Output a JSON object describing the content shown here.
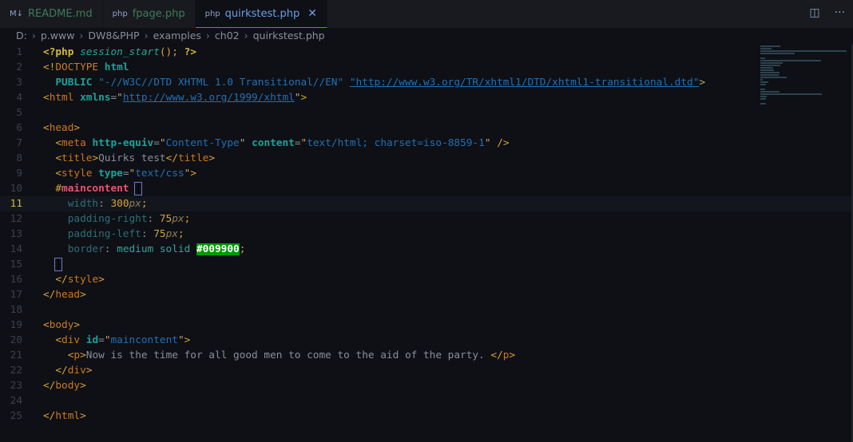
{
  "tabs": [
    {
      "label": "README.md",
      "icon": "markdown-icon",
      "glyph": "M↓",
      "color": "#3f7a5a"
    },
    {
      "label": "fpage.php",
      "icon": "php-icon",
      "glyph": "php",
      "color": "#3f7a5a"
    },
    {
      "label": "quirkstest.php",
      "icon": "php-icon",
      "glyph": "php",
      "active": true
    }
  ],
  "close_glyph": "✕",
  "actions": {
    "split": "◫",
    "more": "···"
  },
  "breadcrumb": [
    "D:",
    "p.www",
    "DW8&PHP",
    "examples",
    "ch02",
    "quirkstest.php"
  ],
  "current_line": 11,
  "lines": [
    [
      [
        "k",
        "<?php"
      ],
      [
        "x",
        " "
      ],
      [
        "f",
        "session_start"
      ],
      [
        "p",
        "();"
      ],
      [
        "x",
        " "
      ],
      [
        "k",
        "?>"
      ]
    ],
    [
      [
        "p",
        "<!"
      ],
      [
        "pl",
        "DOCTYPE"
      ],
      [
        "x",
        " "
      ],
      [
        "a",
        "html"
      ]
    ],
    [
      [
        "x",
        "  "
      ],
      [
        "a",
        "PUBLIC"
      ],
      [
        "x",
        " "
      ],
      [
        "s",
        "\"-//W3C//DTD XHTML 1.0 Transitional//EN\""
      ],
      [
        "x",
        " "
      ],
      [
        "u",
        "\"http://www.w3.org/TR/xhtml1/DTD/xhtml1-transitional.dtd\""
      ],
      [
        "p",
        ">"
      ]
    ],
    [
      [
        "p",
        "<"
      ],
      [
        "t",
        "html"
      ],
      [
        "x",
        " "
      ],
      [
        "a",
        "xmlns"
      ],
      [
        "x",
        "="
      ],
      [
        "q",
        "\""
      ],
      [
        "u",
        "http://www.w3.org/1999/xhtml"
      ],
      [
        "q",
        "\""
      ],
      [
        "p",
        ">"
      ]
    ],
    [],
    [
      [
        "p",
        "<"
      ],
      [
        "t",
        "head"
      ],
      [
        "p",
        ">"
      ]
    ],
    [
      [
        "x",
        "  "
      ],
      [
        "p",
        "<"
      ],
      [
        "t",
        "meta"
      ],
      [
        "x",
        " "
      ],
      [
        "a",
        "http-equiv"
      ],
      [
        "x",
        "="
      ],
      [
        "q",
        "\""
      ],
      [
        "s",
        "Content-Type"
      ],
      [
        "q",
        "\""
      ],
      [
        "x",
        " "
      ],
      [
        "a",
        "content"
      ],
      [
        "x",
        "="
      ],
      [
        "q",
        "\""
      ],
      [
        "s",
        "text/html; charset=iso-8859-1"
      ],
      [
        "q",
        "\""
      ],
      [
        "x",
        " "
      ],
      [
        "p",
        "/>"
      ]
    ],
    [
      [
        "x",
        "  "
      ],
      [
        "p",
        "<"
      ],
      [
        "t",
        "title"
      ],
      [
        "p",
        ">"
      ],
      [
        "x",
        "Quirks test"
      ],
      [
        "p",
        "</"
      ],
      [
        "t",
        "title"
      ],
      [
        "p",
        ">"
      ]
    ],
    [
      [
        "x",
        "  "
      ],
      [
        "p",
        "<"
      ],
      [
        "t",
        "style"
      ],
      [
        "x",
        " "
      ],
      [
        "a",
        "type"
      ],
      [
        "x",
        "="
      ],
      [
        "q",
        "\""
      ],
      [
        "s",
        "text/css"
      ],
      [
        "q",
        "\""
      ],
      [
        "p",
        ">"
      ]
    ],
    [
      [
        "x",
        "  "
      ],
      [
        "p",
        "#"
      ],
      [
        "sel",
        "maincontent"
      ],
      [
        "x",
        " "
      ],
      [
        "br",
        "{"
      ]
    ],
    [
      [
        "x",
        "    "
      ],
      [
        "cp",
        "width"
      ],
      [
        "x",
        ": "
      ],
      [
        "n",
        "300"
      ],
      [
        "un",
        "px"
      ],
      [
        "p",
        ";"
      ]
    ],
    [
      [
        "x",
        "    "
      ],
      [
        "cp",
        "padding-right"
      ],
      [
        "x",
        ": "
      ],
      [
        "n",
        "75"
      ],
      [
        "un",
        "px"
      ],
      [
        "p",
        ";"
      ]
    ],
    [
      [
        "x",
        "    "
      ],
      [
        "cp",
        "padding-left"
      ],
      [
        "x",
        ": "
      ],
      [
        "n",
        "75"
      ],
      [
        "un",
        "px"
      ],
      [
        "p",
        ";"
      ]
    ],
    [
      [
        "x",
        "    "
      ],
      [
        "cp",
        "border"
      ],
      [
        "x",
        ": "
      ],
      [
        "v",
        "medium solid"
      ],
      [
        "x",
        " "
      ],
      [
        "hx",
        "#009900"
      ],
      [
        "p",
        ";"
      ]
    ],
    [
      [
        "x",
        "  "
      ],
      [
        "br",
        "}"
      ]
    ],
    [
      [
        "x",
        "  "
      ],
      [
        "p",
        "</"
      ],
      [
        "t",
        "style"
      ],
      [
        "p",
        ">"
      ]
    ],
    [
      [
        "p",
        "</"
      ],
      [
        "t",
        "head"
      ],
      [
        "p",
        ">"
      ]
    ],
    [],
    [
      [
        "p",
        "<"
      ],
      [
        "t",
        "body"
      ],
      [
        "p",
        ">"
      ]
    ],
    [
      [
        "x",
        "  "
      ],
      [
        "p",
        "<"
      ],
      [
        "t",
        "div"
      ],
      [
        "x",
        " "
      ],
      [
        "a",
        "id"
      ],
      [
        "x",
        "="
      ],
      [
        "q",
        "\""
      ],
      [
        "s",
        "maincontent"
      ],
      [
        "q",
        "\""
      ],
      [
        "p",
        ">"
      ]
    ],
    [
      [
        "x",
        "    "
      ],
      [
        "p",
        "<"
      ],
      [
        "t",
        "p"
      ],
      [
        "p",
        ">"
      ],
      [
        "x",
        "Now is the time for all good men to come to the aid of the party. "
      ],
      [
        "p",
        "</"
      ],
      [
        "t",
        "p"
      ],
      [
        "p",
        ">"
      ]
    ],
    [
      [
        "x",
        "  "
      ],
      [
        "p",
        "</"
      ],
      [
        "t",
        "div"
      ],
      [
        "p",
        ">"
      ]
    ],
    [
      [
        "p",
        "</"
      ],
      [
        "t",
        "body"
      ],
      [
        "p",
        ">"
      ]
    ],
    [],
    [
      [
        "p",
        "</"
      ],
      [
        "t",
        "html"
      ],
      [
        "p",
        ">"
      ]
    ]
  ]
}
